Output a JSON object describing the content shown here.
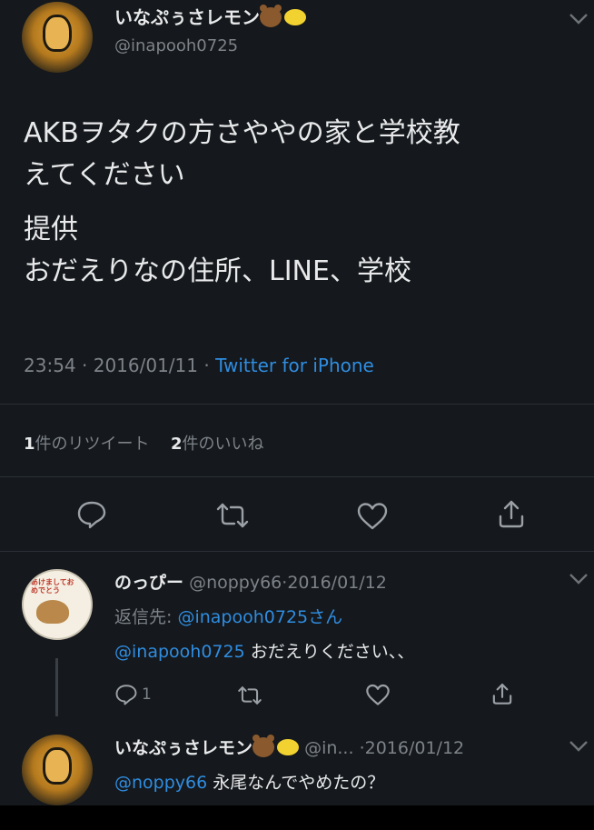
{
  "main_tweet": {
    "display_name": "いなぷぅさレモン",
    "handle": "@inapooh0725",
    "text_line1": "AKBヲタクの方さややの家と学校教",
    "text_line2": "えてください",
    "text_line3": "提供",
    "text_line4": "おだえりなの住所、LINE、学校",
    "time": "23:54",
    "date": "2016/01/11",
    "source": "Twitter for iPhone",
    "retweet_count": "1",
    "retweet_label": "件のリツイート",
    "like_count": "2",
    "like_label": "件のいいね"
  },
  "reply1": {
    "display_name": "のっぴー",
    "handle": "@noppy66",
    "date": "2016/01/12",
    "reply_to_prefix": "返信先:",
    "reply_to_handle": "@inapooh0725さん",
    "mention": "@inapooh0725",
    "text": " おだえりください、、",
    "reply_count": "1",
    "avatar_text": "あけましておめでとう"
  },
  "reply2": {
    "display_name": "いなぷぅさレモン",
    "handle": "@in...",
    "date": "2016/01/12",
    "mention": "@noppy66",
    "text": " 永尾なんでやめたの？"
  },
  "separator": "·",
  "icons": {
    "reply": "reply-icon",
    "retweet": "retweet-icon",
    "like": "heart-icon",
    "share": "share-icon",
    "chevron": "chevron-down-icon"
  },
  "colors": {
    "background": "#15181c",
    "text": "#e7e9ea",
    "muted": "#7d8389",
    "link": "#2f8de0"
  }
}
